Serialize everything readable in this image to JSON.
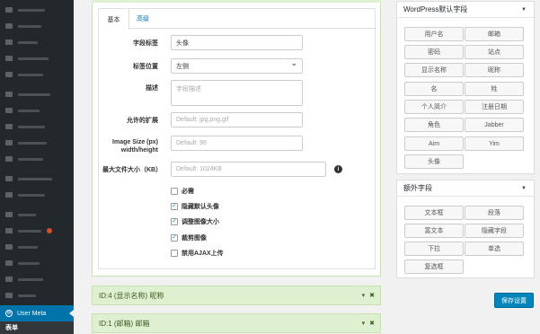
{
  "sidebar": {
    "active_item": "User Meta",
    "sub_item": "表单"
  },
  "field_editor": {
    "tabs": [
      "基本",
      "高级"
    ],
    "field_label": {
      "label": "字段标签",
      "value": "头像"
    },
    "label_position": {
      "label": "标签位置",
      "value": "左侧"
    },
    "description": {
      "label": "描述",
      "placeholder": "字段描述"
    },
    "allowed_ext": {
      "label": "允许的扩展",
      "placeholder": "Default: jpg,png,gif"
    },
    "image_size": {
      "label_line1": "Image Size (px)",
      "label_line2": "width/height",
      "placeholder": "Default: 96"
    },
    "max_size": {
      "label": "最大文件大小（KB）",
      "placeholder": "Default: 1024KB"
    },
    "checkboxes": [
      {
        "label": "必需",
        "checked": false
      },
      {
        "label": "隐藏默认头像",
        "checked": true
      },
      {
        "label": "调整图像大小",
        "checked": true
      },
      {
        "label": "裁剪图像",
        "checked": true
      },
      {
        "label": "禁用AJAX上传",
        "checked": false
      }
    ]
  },
  "collapsed_fields": [
    {
      "title": "ID:4 (显示名称) 昵称"
    },
    {
      "title": "ID:1 (邮箱) 邮箱"
    }
  ],
  "wp_fields_panel": {
    "title": "WordPress默认字段",
    "buttons": [
      "用户名",
      "邮箱",
      "密码",
      "站点",
      "显示名称",
      "昵称",
      "名",
      "姓",
      "个人简介",
      "注册日期",
      "角色",
      "Jabber",
      "Aim",
      "Yim",
      "头像"
    ]
  },
  "extra_fields_panel": {
    "title": "额外字段",
    "buttons": [
      "文本框",
      "段落",
      "富文本",
      "隐藏字段",
      "下拉",
      "单选",
      "复选框"
    ]
  },
  "save_button": "保存设置",
  "colors": {
    "accent": "#0073aa",
    "sidebar": "#23282d",
    "box_header": "#dff0d0",
    "save": "#0085ba"
  }
}
